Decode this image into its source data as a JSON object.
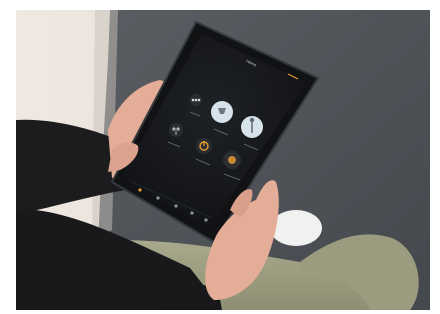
{
  "colors": {
    "background": "#ffffff",
    "wall": "#ece6df",
    "sofa": "#4e5258",
    "sweater": "#1c1c1f",
    "pants": "#a3a385",
    "skin": "#e3ad97",
    "tablet_bezel": "#111214",
    "screen": "#16181b",
    "icon_active": "#d7e3ea",
    "icon_inactive": "#3f4448",
    "accent": "#e39a2c"
  },
  "tablet_ui": {
    "screen_title": "Home",
    "icons": [
      {
        "name": "dots-icon",
        "state": "inactive"
      },
      {
        "name": "lamp-icon",
        "state": "active"
      },
      {
        "name": "floor-lamp-icon",
        "state": "active"
      },
      {
        "name": "bulbs-icon",
        "state": "inactive"
      },
      {
        "name": "power-icon",
        "state": "active"
      },
      {
        "name": "scene-icon",
        "state": "active"
      }
    ],
    "bottom_nav_icons": [
      "home-icon",
      "rooms-icon",
      "scenes-icon",
      "devices-icon",
      "settings-icon"
    ]
  }
}
